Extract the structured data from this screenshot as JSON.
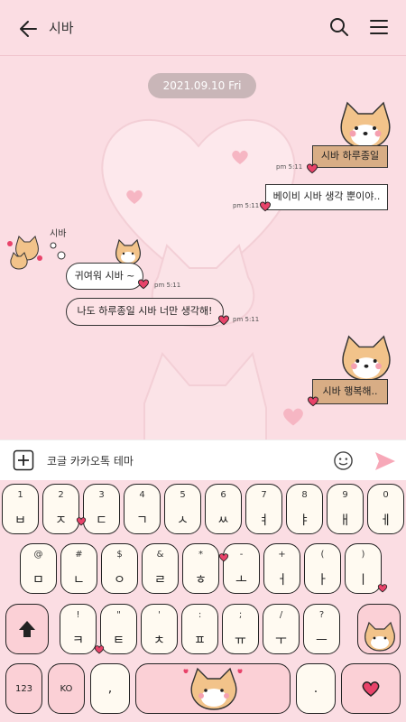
{
  "header": {
    "title": "시바"
  },
  "chat": {
    "date": "2021.09.10 Fri",
    "sender": "시바",
    "messages": [
      {
        "text": "시바 하루종일",
        "time": "pm 5:11"
      },
      {
        "text": "베이비 시바 생각 뿐이야..",
        "time": "pm 5:11"
      },
      {
        "text": "귀여워 시바 ~",
        "time": "pm 5:11"
      },
      {
        "text": "나도 하루종일 시바 너만 생각해!",
        "time": "pm 5:11"
      },
      {
        "text": "시바 행복해..",
        "time": ""
      }
    ]
  },
  "input": {
    "placeholder": "코글 카카오톡 테마"
  },
  "keyboard": {
    "row1": [
      {
        "top": "1",
        "main": "ㅂ"
      },
      {
        "top": "2",
        "main": "ㅈ"
      },
      {
        "top": "3",
        "main": "ㄷ"
      },
      {
        "top": "4",
        "main": "ㄱ"
      },
      {
        "top": "5",
        "main": "ㅅ"
      },
      {
        "top": "6",
        "main": "ㅆ"
      },
      {
        "top": "7",
        "main": "ㅕ"
      },
      {
        "top": "8",
        "main": "ㅑ"
      },
      {
        "top": "9",
        "main": "ㅐ"
      },
      {
        "top": "0",
        "main": "ㅔ"
      }
    ],
    "row2": [
      {
        "top": "@",
        "main": "ㅁ"
      },
      {
        "top": "#",
        "main": "ㄴ"
      },
      {
        "top": "$",
        "main": "ㅇ"
      },
      {
        "top": "&",
        "main": "ㄹ"
      },
      {
        "top": "*",
        "main": "ㅎ"
      },
      {
        "top": "-",
        "main": "ㅗ"
      },
      {
        "top": "+",
        "main": "ㅓ"
      },
      {
        "top": "(",
        "main": "ㅏ"
      },
      {
        "top": ")",
        "main": "ㅣ"
      }
    ],
    "row3": [
      {
        "top": "!",
        "main": "ㅋ"
      },
      {
        "top": "\"",
        "main": "ㅌ"
      },
      {
        "top": "'",
        "main": "ㅊ"
      },
      {
        "top": ":",
        "main": "ㅍ"
      },
      {
        "top": ";",
        "main": "ㅠ"
      },
      {
        "top": "/",
        "main": "ㅜ"
      },
      {
        "top": "?",
        "main": "ㅡ"
      }
    ],
    "num_label": "123",
    "lang_label": "KO",
    "comma": ",",
    "period": "."
  }
}
